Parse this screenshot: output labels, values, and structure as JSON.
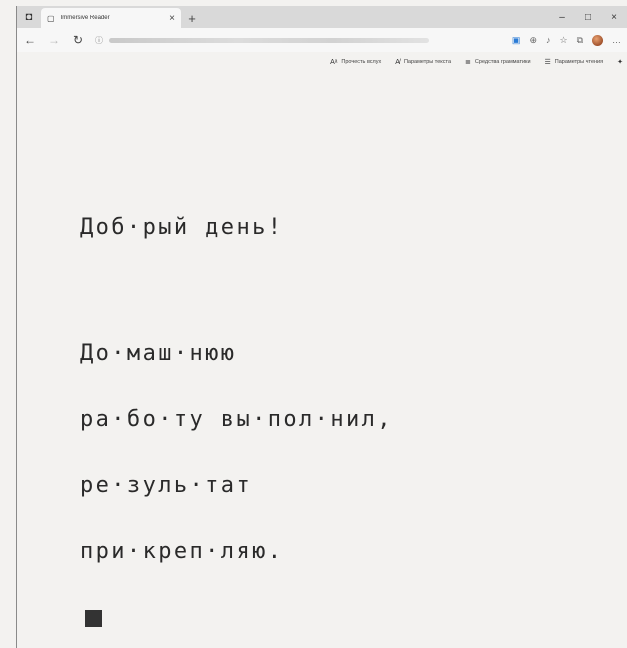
{
  "browser": {
    "tab_title": "Immersive Reader",
    "tab_close": "×",
    "new_tab": "+",
    "window_controls": [
      "–",
      "□",
      "×"
    ],
    "nav": {
      "back": "←",
      "forward": "→",
      "refresh": "↻",
      "info": "ⓘ"
    },
    "address_icons": [
      "reader-view-icon",
      "zoom-icon",
      "read-aloud-icon",
      "favorites-icon",
      "collections-icon"
    ],
    "more": "…"
  },
  "reader_toolbar": {
    "read_aloud": "Прочесть вслух",
    "text_preferences": "Параметры текста",
    "grammar_tools": "Средства грамматики",
    "reading_preferences": "Параметры чтения"
  },
  "content": {
    "greeting": "Доб·рый день!",
    "lines": [
      "До·маш·нюю",
      "ра·бо·ту вы·пол·нил,",
      "ре·зуль·тат",
      "при·креп·ляю."
    ]
  }
}
